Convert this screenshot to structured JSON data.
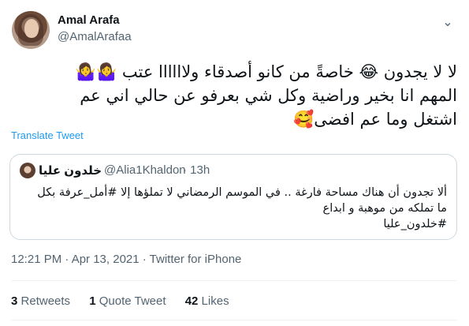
{
  "author": {
    "name": "Amal Arafa",
    "handle": "@AmalArafaa",
    "caret": "⌄"
  },
  "tweet": {
    "line1": "لا لا يجدون 😂 خاصةً من كانو أصدقاء ولاااااا عتب 🤷‍♀️🤷‍♀️",
    "line1_lead": "🤷‍♀️🤷‍♀️",
    "line2": "المهم انا بخير وراضية وكل شي بعرفو عن حالي اني عم",
    "line3": "اشتغل وما عم افضى🥰",
    "translate": "Translate Tweet"
  },
  "quote": {
    "name": "خلدون عليا",
    "handle": "@Alia1Khaldon",
    "time": "· 13h",
    "text1": "ألا تجدون أن هناك مساحة فارغة .. في الموسم الرمضاني لا تملؤها إلا #أمل_عرفة بكل",
    "text2": "ما تملكه من موهبة و ابداع",
    "text3": "#خلدون_عليا"
  },
  "meta": {
    "timestamp": "12:21 PM · Apr 13, 2021 · Twitter for iPhone"
  },
  "stats": {
    "retweets_count": "3",
    "retweets_label": "Retweets",
    "quotes_count": "1",
    "quotes_label": "Quote Tweet",
    "likes_count": "42",
    "likes_label": "Likes"
  }
}
